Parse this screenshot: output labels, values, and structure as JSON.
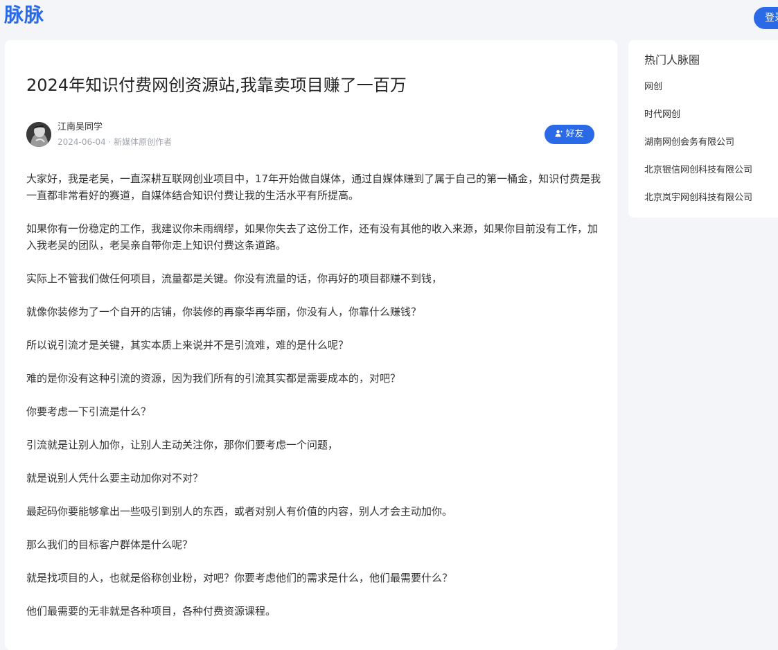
{
  "header": {
    "logo": "脉脉",
    "login_label": "登录"
  },
  "article": {
    "title": "2024年知识付费网创资源站,我靠卖项目赚了一百万",
    "author": {
      "name": "江南吴同学",
      "meta": "2024-06-04 · 新媒体原创作者",
      "friend_label": "好友",
      "friend_icon": "user-add-icon"
    },
    "paragraphs": [
      "大家好，我是老吴，一直深耕互联网创业项目中，17年开始做自媒体，通过自媒体赚到了属于自己的第一桶金，知识付费是我一直都非常看好的赛道，自媒体结合知识付费让我的生活水平有所提高。",
      "如果你有一份稳定的工作，我建议你未雨绸缪，如果你失去了这份工作，还有没有其他的收入来源，如果你目前没有工作，加入我老吴的团队，老吴亲自带你走上知识付费这条道路。",
      "实际上不管我们做任何项目，流量都是关键。你没有流量的话，你再好的项目都赚不到钱，",
      "就像你装修为了一个自开的店铺，你装修的再豪华再华丽，你没有人，你靠什么赚钱？",
      "所以说引流才是关键，其实本质上来说并不是引流难，难的是什么呢？",
      "难的是你没有这种引流的资源，因为我们所有的引流其实都是需要成本的，对吧？",
      "你要考虑一下引流是什么？",
      "引流就是让别人加你，让别人主动关注你，那你们要考虑一个问题，",
      "就是说别人凭什么要主动加你对不对？",
      "最起码你要能够拿出一些吸引到别人的东西，或者对别人有价值的内容，别人才会主动加你。",
      "那么我们的目标客户群体是什么呢？",
      "就是找项目的人，也就是俗称创业粉，对吧？你要考虑他们的需求是什么，他们最需要什么？",
      "他们最需要的无非就是各种项目，各种付费资源课程。"
    ]
  },
  "sidebar": {
    "title": "热门人脉圈",
    "items": [
      "网创",
      "时代网创",
      "湖南网创会务有限公司",
      "北京银信网创科技有限公司",
      "北京岚宇网创科技有限公司"
    ]
  },
  "colors": {
    "accent": "#2b6ae6",
    "background": "#f4f5f9",
    "card": "#ffffff",
    "meta_text": "#a0a4ad"
  }
}
